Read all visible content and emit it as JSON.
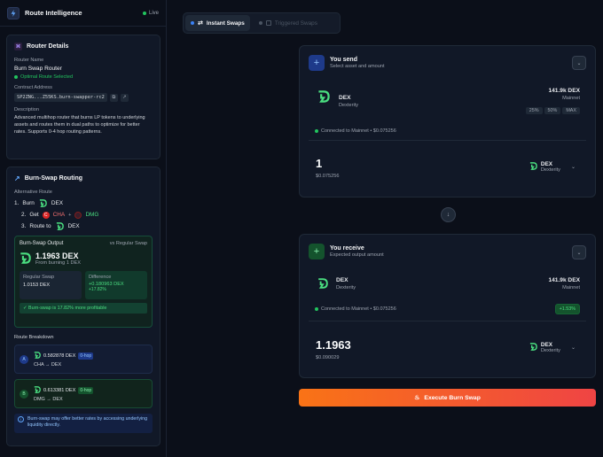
{
  "sidebar": {
    "title": "Route Intelligence",
    "live_label": "Live",
    "router_details": {
      "title": "Router Details",
      "name_label": "Router Name",
      "name_value": "Burn Swap Router",
      "optimal_label": "Optimal Route Selected",
      "contract_label": "Contract Address",
      "contract_value": "SP2ZNG...Z55KS.burn-swapper-rc2",
      "description_label": "Description",
      "description_value": "Advanced multihop router that burns LP tokens to underlying assets and routes them in dual paths to optimize for better rates. Supports 0-4 hop routing patterns."
    },
    "routing": {
      "title": "Burn-Swap Routing",
      "alt_label": "Alternative Route",
      "step1_num": "1.",
      "step1_text": "Burn",
      "step1_token": "DEX",
      "step2_num": "2.",
      "step2_text": "Get",
      "step2_token_a": "CHA",
      "plus": "+",
      "step2_token_b": "DMG",
      "step3_num": "3.",
      "step3_text": "Route to",
      "step3_token": "DEX",
      "output_title": "Burn-Swap Output",
      "output_vs": "vs Regular Swap",
      "output_amount": "1.1963 DEX",
      "output_from": "From burning 1 DEX",
      "regular_label": "Regular Swap",
      "regular_value": "1.0153 DEX",
      "diff_label": "Difference",
      "diff_value": "+0.180963 DEX",
      "diff_pct": "+17.82%",
      "profit_note": "✓ Burn-swap is 17.82% more profitable",
      "breakdown_label": "Route Breakdown",
      "route_a_badge": "A",
      "route_a_amount": "0.582878 DEX",
      "route_a_hop": "0-hop",
      "route_a_path": "CHA → DEX",
      "route_b_badge": "B",
      "route_b_amount": "0.613381 DEX",
      "route_b_hop": "0-hop",
      "route_b_path": "DMG → DEX",
      "info_note": "Burn-swap may offer better rates by accessing underlying liquidity directly."
    }
  },
  "tabs": {
    "instant": "Instant Swaps",
    "triggered": "Triggered Swaps"
  },
  "send": {
    "title": "You send",
    "subtitle": "Select asset and amount",
    "token": "DEX",
    "token_name": "Dexterity",
    "balance": "141.9k DEX",
    "network": "Mainnet",
    "pct_25": "25%",
    "pct_50": "50%",
    "pct_max": "MAX",
    "connected": "Connected to Mainnet • $0.075256",
    "amount": "1",
    "usd": "$0.075256",
    "selector_token": "DEX",
    "selector_name": "Dexterity"
  },
  "receive": {
    "title": "You receive",
    "subtitle": "Expected output amount",
    "token": "DEX",
    "token_name": "Dexterity",
    "balance": "141.9k DEX",
    "network": "Mainnet",
    "connected": "Connected to Mainnet • $0.075256",
    "badge": "+1.53%",
    "amount": "1.1963",
    "usd": "$0.090029",
    "selector_token": "DEX",
    "selector_name": "Dexterity"
  },
  "execute_label": "Execute Burn Swap",
  "colors": {
    "accent": "#3b82f6",
    "green": "#22c55e",
    "dex_green": "#4ade80",
    "exec_start": "#f97316",
    "exec_end": "#ef4444"
  }
}
